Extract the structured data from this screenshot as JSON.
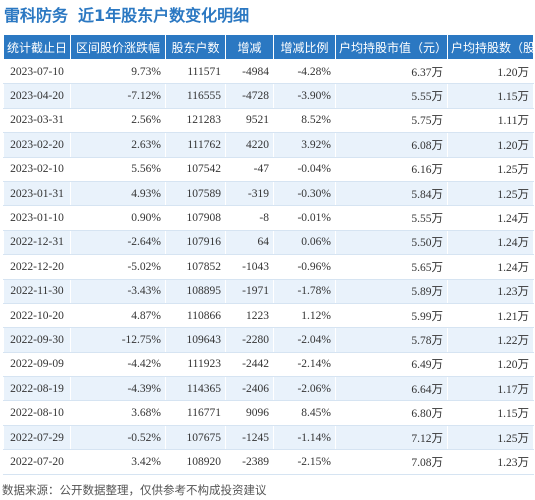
{
  "header": {
    "stock_name": "雷科防务",
    "subtitle": "近1年股东户数变化明细"
  },
  "table": {
    "columns": [
      "统计截止日",
      "区间股价涨跌幅",
      "股东户数",
      "增减",
      "增减比例",
      "户均持股市值（元）",
      "户均持股数（股）"
    ],
    "rows": [
      {
        "date": "2023-07-10",
        "price_change": "9.73%",
        "holders": "111571",
        "delta": "-4984",
        "delta_pct": "-4.28%",
        "avg_value": "6.37万",
        "avg_shares": "1.20万"
      },
      {
        "date": "2023-04-20",
        "price_change": "-7.12%",
        "holders": "116555",
        "delta": "-4728",
        "delta_pct": "-3.90%",
        "avg_value": "5.55万",
        "avg_shares": "1.15万"
      },
      {
        "date": "2023-03-31",
        "price_change": "2.56%",
        "holders": "121283",
        "delta": "9521",
        "delta_pct": "8.52%",
        "avg_value": "5.75万",
        "avg_shares": "1.11万"
      },
      {
        "date": "2023-02-20",
        "price_change": "2.63%",
        "holders": "111762",
        "delta": "4220",
        "delta_pct": "3.92%",
        "avg_value": "6.08万",
        "avg_shares": "1.20万"
      },
      {
        "date": "2023-02-10",
        "price_change": "5.56%",
        "holders": "107542",
        "delta": "-47",
        "delta_pct": "-0.04%",
        "avg_value": "6.16万",
        "avg_shares": "1.25万"
      },
      {
        "date": "2023-01-31",
        "price_change": "4.93%",
        "holders": "107589",
        "delta": "-319",
        "delta_pct": "-0.30%",
        "avg_value": "5.84万",
        "avg_shares": "1.25万"
      },
      {
        "date": "2023-01-10",
        "price_change": "0.90%",
        "holders": "107908",
        "delta": "-8",
        "delta_pct": "-0.01%",
        "avg_value": "5.55万",
        "avg_shares": "1.24万"
      },
      {
        "date": "2022-12-31",
        "price_change": "-2.64%",
        "holders": "107916",
        "delta": "64",
        "delta_pct": "0.06%",
        "avg_value": "5.50万",
        "avg_shares": "1.24万"
      },
      {
        "date": "2022-12-20",
        "price_change": "-5.02%",
        "holders": "107852",
        "delta": "-1043",
        "delta_pct": "-0.96%",
        "avg_value": "5.65万",
        "avg_shares": "1.24万"
      },
      {
        "date": "2022-11-30",
        "price_change": "-3.43%",
        "holders": "108895",
        "delta": "-1971",
        "delta_pct": "-1.78%",
        "avg_value": "5.89万",
        "avg_shares": "1.23万"
      },
      {
        "date": "2022-10-20",
        "price_change": "4.87%",
        "holders": "110866",
        "delta": "1223",
        "delta_pct": "1.12%",
        "avg_value": "5.99万",
        "avg_shares": "1.21万"
      },
      {
        "date": "2022-09-30",
        "price_change": "-12.75%",
        "holders": "109643",
        "delta": "-2280",
        "delta_pct": "-2.04%",
        "avg_value": "5.78万",
        "avg_shares": "1.22万"
      },
      {
        "date": "2022-09-09",
        "price_change": "-4.42%",
        "holders": "111923",
        "delta": "-2442",
        "delta_pct": "-2.14%",
        "avg_value": "6.49万",
        "avg_shares": "1.20万"
      },
      {
        "date": "2022-08-19",
        "price_change": "-4.39%",
        "holders": "114365",
        "delta": "-2406",
        "delta_pct": "-2.06%",
        "avg_value": "6.64万",
        "avg_shares": "1.17万"
      },
      {
        "date": "2022-08-10",
        "price_change": "3.68%",
        "holders": "116771",
        "delta": "9096",
        "delta_pct": "8.45%",
        "avg_value": "6.80万",
        "avg_shares": "1.15万"
      },
      {
        "date": "2022-07-29",
        "price_change": "-0.52%",
        "holders": "107675",
        "delta": "-1245",
        "delta_pct": "-1.14%",
        "avg_value": "7.12万",
        "avg_shares": "1.25万"
      },
      {
        "date": "2022-07-20",
        "price_change": "3.42%",
        "holders": "108920",
        "delta": "-2389",
        "delta_pct": "-2.15%",
        "avg_value": "7.08万",
        "avg_shares": "1.23万"
      }
    ]
  },
  "footer": {
    "source": "数据来源：公开数据整理，仅供参考不构成投资建议"
  },
  "colors": {
    "header_blue": "#2b78c2",
    "up_red": "#e8262d",
    "down_green": "#2e9a3b",
    "stripe": "#e9f2fb"
  }
}
